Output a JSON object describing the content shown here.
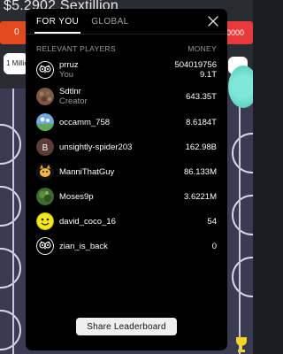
{
  "game": {
    "money": "$5.2902 Sextillion",
    "left_button": "0",
    "right_button": "0000",
    "left_chip": "1 Millio"
  },
  "leaderboard": {
    "tabs": [
      {
        "label": "FOR YOU",
        "active": true
      },
      {
        "label": "GLOBAL",
        "active": false
      }
    ],
    "headers": {
      "players": "RELEVANT PLAYERS",
      "money": "MONEY"
    },
    "rows": [
      {
        "name": "prruz",
        "sub": "You",
        "money": "504019756",
        "money2": "9.1T",
        "avatar": "owl-icon"
      },
      {
        "name": "Sdtlnr",
        "sub": "Creator",
        "money": "643.35T",
        "avatar": "brown-texture-avatar"
      },
      {
        "name": "occamm_758",
        "sub": "",
        "money": "8.6184T",
        "avatar": "sky-avatar"
      },
      {
        "name": "unsightly-spider203",
        "sub": "",
        "money": "162.98B",
        "avatar": "letter-b-avatar",
        "initial": "B"
      },
      {
        "name": "ManniThatGuy",
        "sub": "",
        "money": "86.133M",
        "avatar": "cat-avatar"
      },
      {
        "name": "Moses9p",
        "sub": "",
        "money": "3.6221M",
        "avatar": "nature-avatar"
      },
      {
        "name": "david_coco_16",
        "sub": "",
        "money": "54",
        "avatar": "smiley-icon"
      },
      {
        "name": "zian_is_back",
        "sub": "",
        "money": "0",
        "avatar": "owl-icon"
      }
    ],
    "share_label": "Share Leaderboard"
  },
  "colors": {
    "modal_bg": "#000000",
    "accent_orange": "#e04a1e",
    "accent_red": "#e83a3a",
    "teal": "#7fe9d8"
  }
}
